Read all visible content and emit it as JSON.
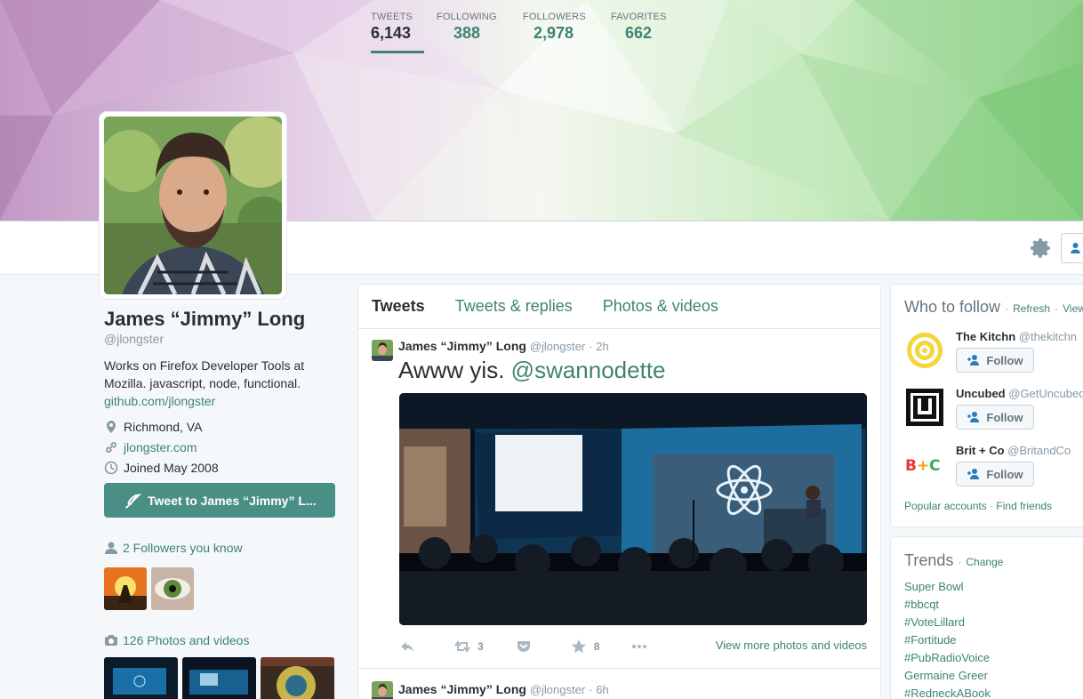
{
  "profile": {
    "name": "James “Jimmy” Long",
    "handle": "@jlongster",
    "bio": "Works on Firefox Developer Tools at Mozilla. javascript, node, functional.",
    "bio_link": "github.com/jlongster",
    "location": "Richmond, VA",
    "website": "jlongster.com",
    "joined": "Joined May 2008",
    "tweet_to_label": "Tweet to James “Jimmy” L...",
    "followers_you_know": "2 Followers you know",
    "photos_videos": "126 Photos and videos"
  },
  "stats": [
    {
      "label": "TWEETS",
      "value": "6,143"
    },
    {
      "label": "FOLLOWING",
      "value": "388"
    },
    {
      "label": "FOLLOWERS",
      "value": "2,978"
    },
    {
      "label": "FAVORITES",
      "value": "662"
    }
  ],
  "timeline": {
    "tabs": [
      "Tweets",
      "Tweets & replies",
      "Photos & videos"
    ],
    "tweets": [
      {
        "name": "James “Jimmy” Long",
        "handle": "@jlongster",
        "time": "2h",
        "text": "Awww yis.",
        "mention": "@swannodette",
        "retweets": "3",
        "favorites": "8",
        "more_label": "View more photos and videos"
      },
      {
        "name": "James “Jimmy” Long",
        "handle": "@jlongster",
        "time": "6h"
      }
    ]
  },
  "who_to_follow": {
    "title": "Who to follow",
    "refresh": "Refresh",
    "view_all": "View a",
    "follow_label": "Follow",
    "accounts": [
      {
        "name": "The Kitchn",
        "handle": "@thekitchn"
      },
      {
        "name": "Uncubed",
        "handle": "@GetUncubed"
      },
      {
        "name": "Brit + Co",
        "handle": "@BritandCo"
      }
    ],
    "popular": "Popular accounts",
    "find_friends": "Find friends"
  },
  "trends": {
    "title": "Trends",
    "change": "Change",
    "items": [
      "Super Bowl",
      "#bbcqt",
      "#VoteLillard",
      "#Fortitude",
      "#PubRadioVoice",
      "Germaine Greer",
      "#RedneckABook"
    ]
  },
  "colors": {
    "accent": "#3e8374",
    "button": "#4a8f86",
    "banner_left": "#c79ac7",
    "banner_right": "#8fd28a"
  }
}
